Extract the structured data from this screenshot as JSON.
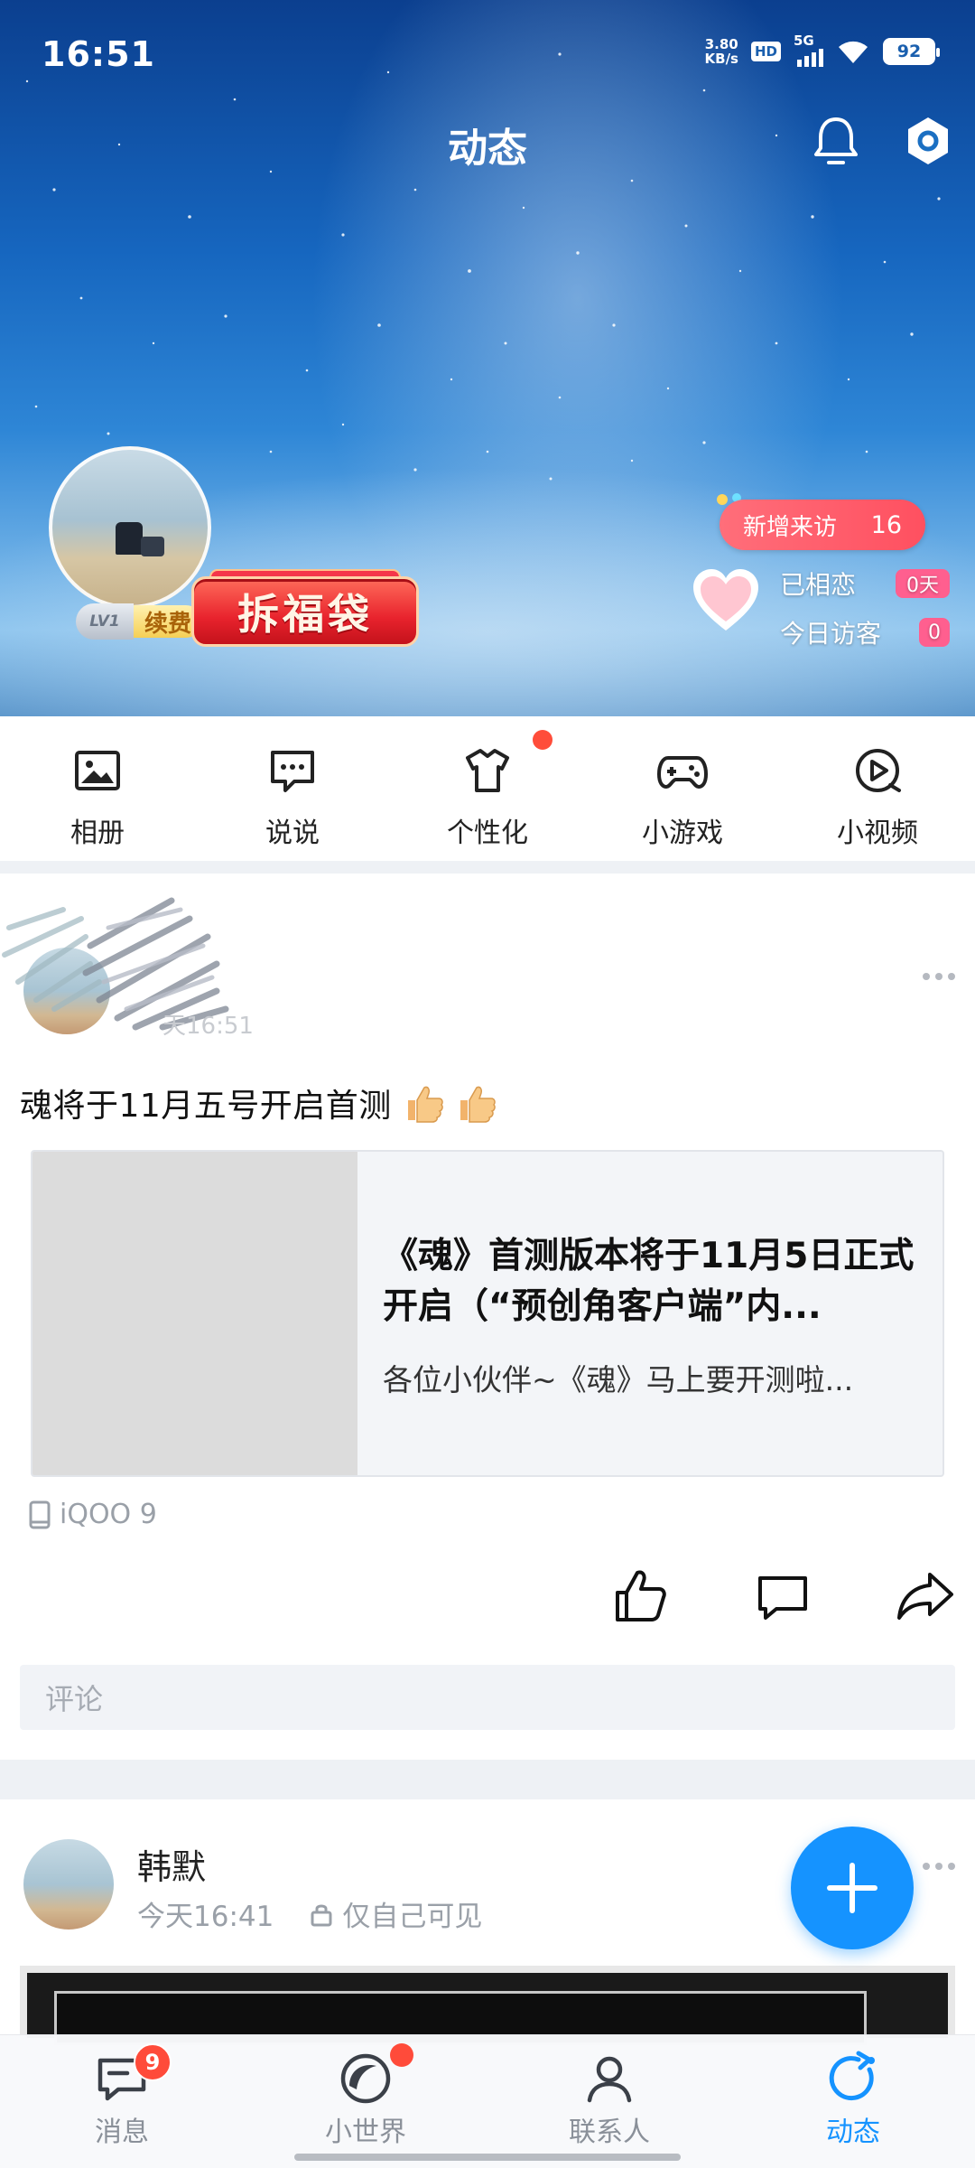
{
  "status_bar": {
    "time": "16:51",
    "net_speed_value": "3.80",
    "net_speed_unit": "KB/s",
    "hd": "HD",
    "network": "5G",
    "battery": "92"
  },
  "header": {
    "title": "动态",
    "icons": [
      "bell-icon",
      "settings-icon"
    ]
  },
  "profile": {
    "level": "LV1",
    "renew_label": "续费",
    "lucky_bag_label": "拆福袋",
    "new_visitors_label": "新增来访",
    "new_visitors_count": "16",
    "in_love_label": "已相恋",
    "in_love_value": "0天",
    "today_visitors_label": "今日访客",
    "today_visitors_value": "0"
  },
  "quick_nav": [
    {
      "label": "相册",
      "icon": "album-icon"
    },
    {
      "label": "说说",
      "icon": "chat-icon"
    },
    {
      "label": "个性化",
      "icon": "tshirt-icon"
    },
    {
      "label": "小游戏",
      "icon": "gamepad-icon"
    },
    {
      "label": "小视频",
      "icon": "video-icon"
    }
  ],
  "post1": {
    "time": "天16:51",
    "text": "魂将于11月五号开启首测",
    "link_title": "《魂》首测版本将于11月5日正式开启（“预创角客户端”内...",
    "link_desc": "各位小伙伴~《魂》马上要开测啦...",
    "device": "iQOO 9",
    "comment_placeholder": "评论"
  },
  "post2": {
    "name": "韩默",
    "time": "今天16:41",
    "visibility": "仅自己可见"
  },
  "tabbar": {
    "tabs": [
      {
        "label": "消息",
        "icon": "message-icon"
      },
      {
        "label": "小世界",
        "icon": "world-icon"
      },
      {
        "label": "联系人",
        "icon": "contacts-icon"
      },
      {
        "label": "动态",
        "icon": "feed-icon"
      }
    ],
    "message_badge": "9",
    "active_tab": "动态"
  },
  "colors": {
    "accent": "#1593ff",
    "badge_red": "#ff4b3a",
    "visit_pill": "#ff5060",
    "love_badge": "#ff5f8f"
  }
}
